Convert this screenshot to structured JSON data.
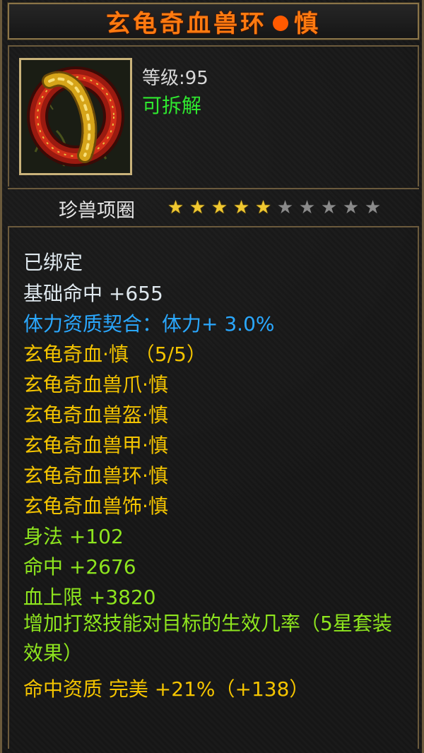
{
  "item": {
    "name_part1": "玄龟奇血兽环",
    "name_part2": "慎",
    "level_label": "等级:95",
    "dismantle_label": "可拆解",
    "type_label": "珍兽项圈",
    "stars_filled": 5,
    "stars_total": 10
  },
  "properties": {
    "bound": "已绑定",
    "base_stat": "基础命中  +655",
    "aptitude_match": "体力资质契合：体力+ 3.0%",
    "set_name": "玄龟奇血·慎 （5/5）",
    "set_items": [
      "玄龟奇血兽爪·慎",
      "玄龟奇血兽盔·慎",
      "玄龟奇血兽甲·慎",
      "玄龟奇血兽环·慎",
      "玄龟奇血兽饰·慎"
    ],
    "attr_1": "身法  +102",
    "attr_2": "命中  +2676",
    "attr_3": "血上限  +3820",
    "set_bonus": "增加打怒技能对目标的生效几率（5星套装效果）",
    "aptitude": "命中资质   完美  +21%（+138）"
  },
  "colors": {
    "title": "#ff7a10",
    "dismantle": "#2fe82f",
    "bound": "#dfe8ee",
    "aptitude_match": "#2aa8ff",
    "set": "#f4c400",
    "attribute": "#8ee51e"
  }
}
